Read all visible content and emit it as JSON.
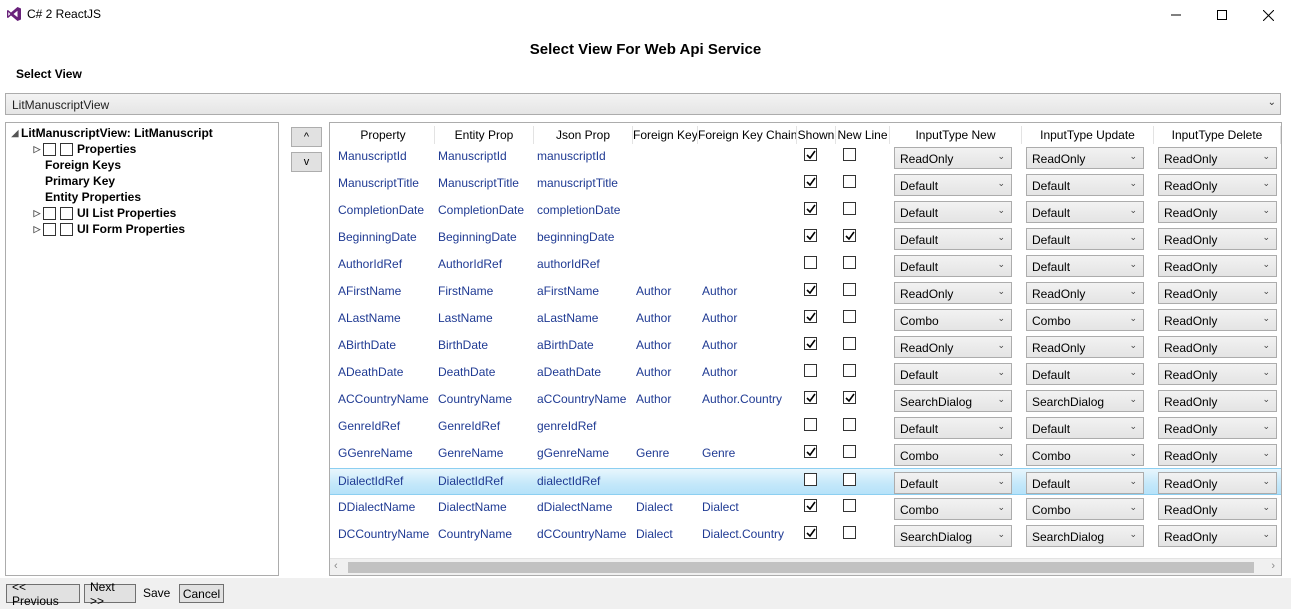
{
  "window": {
    "title": "C# 2 ReactJS"
  },
  "heading": "Select View For Web Api Service",
  "select_view_label": "Select View",
  "view_combo_value": "LitManuscriptView",
  "tree": {
    "root": "LitManuscriptView: LitManuscript",
    "items": [
      "Properties",
      "Foreign Keys",
      "Primary Key",
      "Entity Properties",
      "UI List Properties",
      "UI Form Properties"
    ]
  },
  "move_buttons": {
    "up": "^",
    "down": "v"
  },
  "columns": [
    "Property",
    "Entity Prop",
    "Json Prop",
    "Foreign Key",
    "Foreign Key Chain",
    "Shown",
    "New Line",
    "InputType New",
    "InputType Update",
    "InputType Delete"
  ],
  "rows": [
    {
      "prop": "ManuscriptId",
      "entity": "ManuscriptId",
      "json": "manuscriptId",
      "fk": "",
      "fkc": "",
      "shown": true,
      "newline": false,
      "new": "ReadOnly",
      "update": "ReadOnly",
      "delete": "ReadOnly"
    },
    {
      "prop": "ManuscriptTitle",
      "entity": "ManuscriptTitle",
      "json": "manuscriptTitle",
      "fk": "",
      "fkc": "",
      "shown": true,
      "newline": false,
      "new": "Default",
      "update": "Default",
      "delete": "ReadOnly"
    },
    {
      "prop": "CompletionDate",
      "entity": "CompletionDate",
      "json": "completionDate",
      "fk": "",
      "fkc": "",
      "shown": true,
      "newline": false,
      "new": "Default",
      "update": "Default",
      "delete": "ReadOnly"
    },
    {
      "prop": "BeginningDate",
      "entity": "BeginningDate",
      "json": "beginningDate",
      "fk": "",
      "fkc": "",
      "shown": true,
      "newline": true,
      "new": "Default",
      "update": "Default",
      "delete": "ReadOnly"
    },
    {
      "prop": "AuthorIdRef",
      "entity": "AuthorIdRef",
      "json": "authorIdRef",
      "fk": "",
      "fkc": "",
      "shown": false,
      "newline": false,
      "new": "Default",
      "update": "Default",
      "delete": "ReadOnly"
    },
    {
      "prop": "AFirstName",
      "entity": "FirstName",
      "json": "aFirstName",
      "fk": "Author",
      "fkc": "Author",
      "shown": true,
      "newline": false,
      "new": "ReadOnly",
      "update": "ReadOnly",
      "delete": "ReadOnly"
    },
    {
      "prop": "ALastName",
      "entity": "LastName",
      "json": "aLastName",
      "fk": "Author",
      "fkc": "Author",
      "shown": true,
      "newline": false,
      "new": "Combo",
      "update": "Combo",
      "delete": "ReadOnly"
    },
    {
      "prop": "ABirthDate",
      "entity": "BirthDate",
      "json": "aBirthDate",
      "fk": "Author",
      "fkc": "Author",
      "shown": true,
      "newline": false,
      "new": "ReadOnly",
      "update": "ReadOnly",
      "delete": "ReadOnly"
    },
    {
      "prop": "ADeathDate",
      "entity": "DeathDate",
      "json": "aDeathDate",
      "fk": "Author",
      "fkc": "Author",
      "shown": false,
      "newline": false,
      "new": "Default",
      "update": "Default",
      "delete": "ReadOnly"
    },
    {
      "prop": "ACCountryName",
      "entity": "CountryName",
      "json": "aCCountryName",
      "fk": "Author",
      "fkc": "Author.Country",
      "shown": true,
      "newline": true,
      "new": "SearchDialog",
      "update": "SearchDialog",
      "delete": "ReadOnly"
    },
    {
      "prop": "GenreIdRef",
      "entity": "GenreIdRef",
      "json": "genreIdRef",
      "fk": "",
      "fkc": "",
      "shown": false,
      "newline": false,
      "new": "Default",
      "update": "Default",
      "delete": "ReadOnly"
    },
    {
      "prop": "GGenreName",
      "entity": "GenreName",
      "json": "gGenreName",
      "fk": "Genre",
      "fkc": "Genre",
      "shown": true,
      "newline": false,
      "new": "Combo",
      "update": "Combo",
      "delete": "ReadOnly"
    },
    {
      "prop": "DialectIdRef",
      "entity": "DialectIdRef",
      "json": "dialectIdRef",
      "fk": "",
      "fkc": "",
      "shown": false,
      "newline": false,
      "new": "Default",
      "update": "Default",
      "delete": "ReadOnly"
    },
    {
      "prop": "DDialectName",
      "entity": "DialectName",
      "json": "dDialectName",
      "fk": "Dialect",
      "fkc": "Dialect",
      "shown": true,
      "newline": false,
      "new": "Combo",
      "update": "Combo",
      "delete": "ReadOnly"
    },
    {
      "prop": "DCCountryName",
      "entity": "CountryName",
      "json": "dCCountryName",
      "fk": "Dialect",
      "fkc": "Dialect.Country",
      "shown": true,
      "newline": false,
      "new": "SearchDialog",
      "update": "SearchDialog",
      "delete": "ReadOnly"
    }
  ],
  "selected_row": "DialectIdRef",
  "bottom": {
    "previous": "<< Previous",
    "next": "Next >>",
    "save": "Save",
    "cancel": "Cancel"
  },
  "colors": {
    "accent_purple": "#68217a",
    "link_blue": "#1f3a93",
    "selection": "#c4e8fa"
  }
}
